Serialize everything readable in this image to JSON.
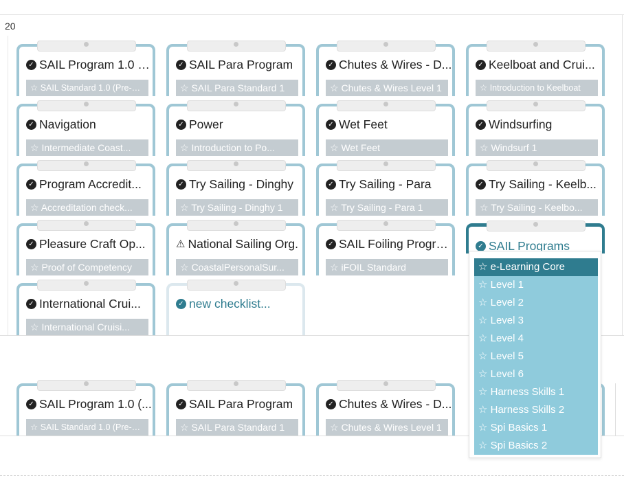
{
  "week": "20",
  "star": "☆",
  "check": "✓",
  "warn": "⚠",
  "cards": [
    {
      "title": "SAIL Program 1.0 (V...",
      "sub": "SAIL Standard 1.0 (Pre-20...",
      "icon": "check"
    },
    {
      "title": "SAIL Para Program",
      "sub": "SAIL Para Standard 1",
      "icon": "check"
    },
    {
      "title": "Chutes & Wires - D...",
      "sub": "Chutes & Wires Level 1",
      "icon": "check"
    },
    {
      "title": "Keelboat and Crui...",
      "sub": "Introduction to Keelboat",
      "icon": "check"
    },
    {
      "title": "Navigation",
      "sub": "Intermediate Coast...",
      "icon": "check"
    },
    {
      "title": "Power",
      "sub": "Introduction to Po...",
      "icon": "check"
    },
    {
      "title": "Wet Feet",
      "sub": "Wet Feet",
      "icon": "check"
    },
    {
      "title": "Windsurfing",
      "sub": "Windsurf 1",
      "icon": "check"
    },
    {
      "title": "Program Accredit...",
      "sub": "Accreditation check...",
      "icon": "check"
    },
    {
      "title": "Try Sailing - Dinghy",
      "sub": "Try Sailing - Dinghy 1",
      "icon": "check"
    },
    {
      "title": "Try Sailing - Para",
      "sub": "Try Sailing - Para 1",
      "icon": "check"
    },
    {
      "title": "Try Sailing - Keelb...",
      "sub": "Try Sailing - Keelbo...",
      "icon": "check"
    },
    {
      "title": "Pleasure Craft Op...",
      "sub": "Proof of Competency",
      "icon": "check"
    },
    {
      "title": "National Sailing Org.",
      "sub": "CoastalPersonalSur...",
      "icon": "warn"
    },
    {
      "title": "SAIL Foiling Program",
      "sub": "iFOIL Standard",
      "icon": "check"
    },
    {
      "title": "SAIL Programs",
      "icon": "check"
    },
    {
      "title": "International Crui...",
      "sub": "International Cruisi...",
      "icon": "check"
    },
    {
      "title": "new checklist...",
      "icon": "check"
    },
    {
      "title": "SAIL Program 1.0 (...",
      "sub": "SAIL Standard 1.0 (Pre-20...",
      "icon": "check"
    },
    {
      "title": "SAIL Para Program",
      "sub": "SAIL Para Standard 1",
      "icon": "check"
    },
    {
      "title": "Chutes & Wires - D...",
      "sub": "Chutes & Wires Level 1",
      "icon": "check"
    }
  ],
  "dropdown": {
    "selected_index": 0,
    "items": [
      "e-Learning Core",
      "Level 1",
      "Level 2",
      "Level 3",
      "Level 4",
      "Level 5",
      "Level 6",
      "Harness Skills 1",
      "Harness Skills 2",
      "Spi Basics 1",
      "Spi Basics 2"
    ]
  },
  "colors": {
    "accent": "#2f7c8f",
    "card_border": "#9fc7d5",
    "dropdown_item": "#8fcbdc",
    "sub_bg": "#c4ccd1"
  }
}
